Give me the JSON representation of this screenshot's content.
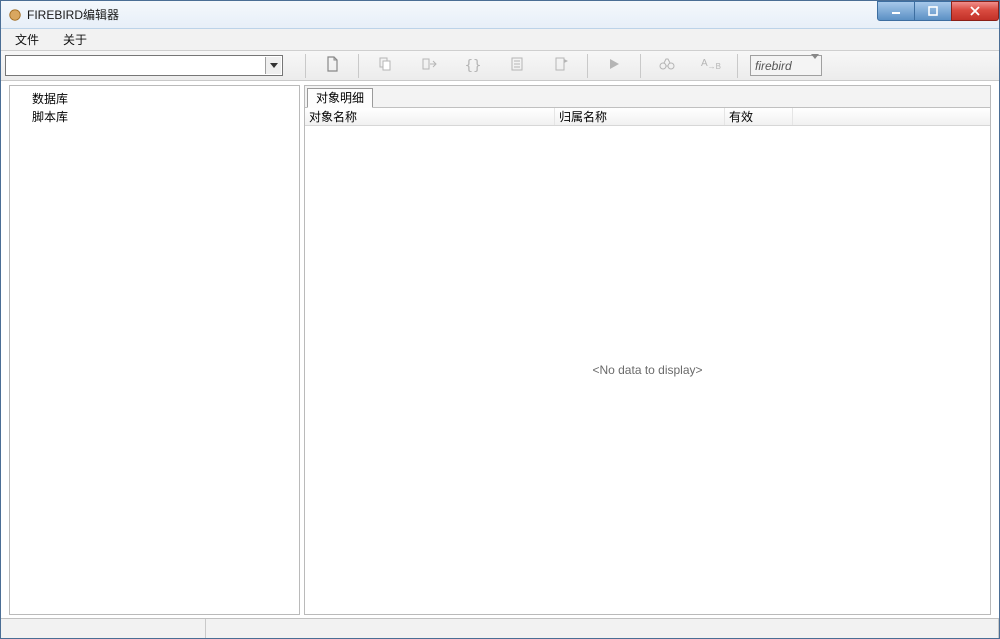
{
  "window": {
    "title": "FIREBIRD编辑器"
  },
  "menubar": {
    "file": "文件",
    "about": "关于"
  },
  "toolbar": {
    "db_combo_value": "",
    "type_combo_value": "firebird",
    "icons": {
      "new_doc": "new-document-icon",
      "copy_doc": "copy-document-icon",
      "export_right": "export-right-icon",
      "braces": "braces-icon",
      "list_doc": "list-document-icon",
      "flagged_doc": "flagged-document-icon",
      "play": "play-icon",
      "binoculars": "binoculars-icon",
      "replace_ab": "find-replace-icon"
    }
  },
  "sidebar": {
    "items": [
      {
        "label": "数据库"
      },
      {
        "label": "脚本库"
      }
    ]
  },
  "main": {
    "tab_label": "对象明细",
    "columns": {
      "name": "对象名称",
      "owner": "归属名称",
      "valid": "有效"
    },
    "empty_text": "<No data to display>"
  }
}
